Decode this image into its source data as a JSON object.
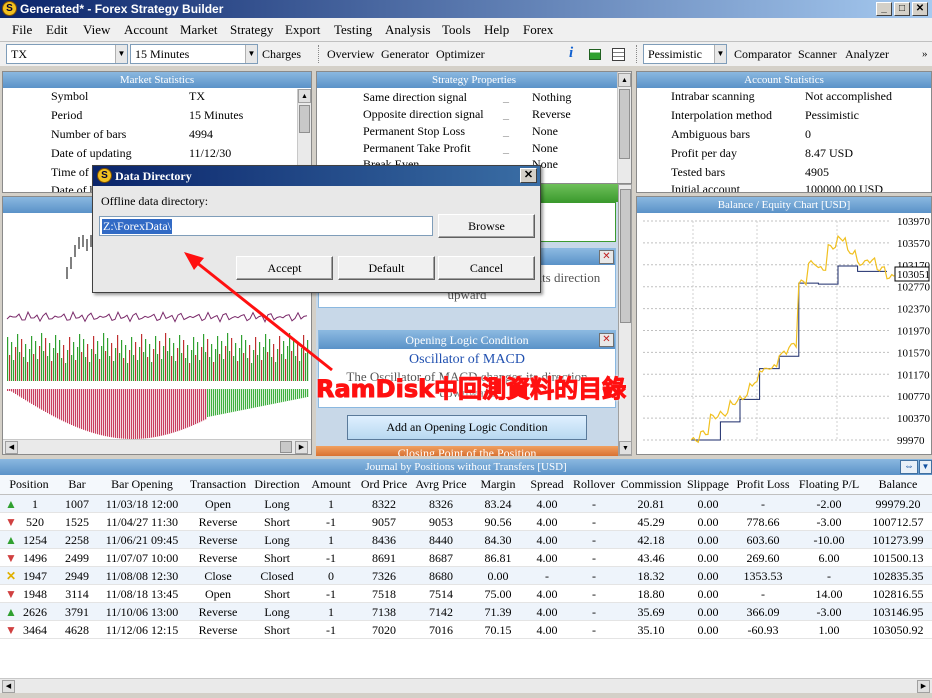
{
  "window": {
    "title": "Generated* - Forex Strategy Builder",
    "logo_letter": "S",
    "btn_min": "_",
    "btn_max": "□",
    "btn_close": "✕"
  },
  "menu": [
    "File",
    "Edit",
    "View",
    "Account",
    "Market",
    "Strategy",
    "Export",
    "Testing",
    "Analysis",
    "Tools",
    "Help",
    "Forex"
  ],
  "toolbar": {
    "symbol": "TX",
    "period": "15 Minutes",
    "charges": "Charges",
    "links": [
      "Overview",
      "Generator",
      "Optimizer"
    ],
    "info_glyph": "i",
    "mode": "Pessimistic",
    "links2": [
      "Comparator",
      "Scanner",
      "Analyzer"
    ]
  },
  "market_stats": {
    "title": "Market Statistics",
    "rows": [
      [
        "Symbol",
        "TX"
      ],
      [
        "Period",
        "15 Minutes"
      ],
      [
        "Number of bars",
        "4994"
      ],
      [
        "Date of updating",
        "11/12/30"
      ],
      [
        "Time of",
        ""
      ],
      [
        "Date of b",
        ""
      ]
    ]
  },
  "strategy_props": {
    "title": "Strategy Properties",
    "rows": [
      [
        "Same direction signal",
        "_",
        "Nothing"
      ],
      [
        "Opposite direction signal",
        "_",
        "Reverse"
      ],
      [
        "Permanent Stop Loss",
        "_",
        "None"
      ],
      [
        "Permanent Take Profit",
        "_",
        "None"
      ],
      [
        "Break Even",
        "",
        "None"
      ]
    ]
  },
  "account_stats": {
    "title": "Account Statistics",
    "rows": [
      [
        "Intrabar scanning",
        "Not accomplished"
      ],
      [
        "Interpolation method",
        "Pessimistic"
      ],
      [
        "Ambiguous bars",
        "0"
      ],
      [
        "Profit per day",
        "8.47 USD"
      ],
      [
        "Tested bars",
        "4905"
      ],
      [
        "Initial account",
        "100000.00 USD"
      ]
    ]
  },
  "logic": {
    "close_glyph": "✕",
    "filter_text": "The Market Facilitation Index changes its direction upward",
    "opening_title": "Opening Logic Condition",
    "opening_indicator": "Oscillator of MACD",
    "opening_text_a": "The Oscillator of MACD changes its direction",
    "opening_text_b": "downward",
    "add_button": "Add an Opening Logic Condition",
    "closing_title": "Closing Point of the Position"
  },
  "balance_chart": {
    "title": "Balance / Equity Chart [USD]",
    "current_value": "103051"
  },
  "chart_data": {
    "type": "line",
    "title": "Balance / Equity Chart [USD]",
    "y_ticks": [
      "103970",
      "103570",
      "103170",
      "102770",
      "102370",
      "101970",
      "101570",
      "101170",
      "100770",
      "100370",
      "99970"
    ],
    "ylim": [
      99970,
      103970
    ],
    "series": [
      {
        "name": "Balance",
        "color": "#1a2a6a",
        "values": [
          99970,
          99970,
          99970,
          100300,
          100300,
          100712,
          100712,
          101274,
          101274,
          101500,
          101500,
          102835,
          102835,
          102817,
          102817,
          103147,
          103147,
          103051,
          103051,
          103051,
          103051
        ]
      },
      {
        "name": "Equity",
        "color": "#f0c020",
        "values": [
          99970,
          100100,
          100400,
          100450,
          100650,
          100750,
          101000,
          101250,
          101300,
          101550,
          101700,
          102850,
          103200,
          103100,
          103500,
          103650,
          103400,
          103200,
          103250,
          103100,
          102950
        ]
      }
    ]
  },
  "dialog": {
    "title": "Data Directory",
    "label": "Offline data directory:",
    "path": "Z:\\ForexData\\",
    "browse": "Browse",
    "accept": "Accept",
    "default": "Default",
    "cancel": "Cancel"
  },
  "annotation": "RamDisk中回測資料的目錄",
  "journal": {
    "title": "Journal by Positions without Transfers [USD]",
    "headers": [
      "Position",
      "Bar",
      "Bar Opening Time",
      "Transaction",
      "Direction",
      "Amount",
      "Ord Price",
      "Avrg Price",
      "Margin",
      "Spread",
      "Rollover",
      "Commission",
      "Slippage",
      "Profit Loss",
      "Floating P/L",
      "Balance"
    ],
    "rows": [
      {
        "icon": "up",
        "cells": [
          "1",
          "1007",
          "11/03/18 12:00",
          "Open",
          "Long",
          "1",
          "8322",
          "8326",
          "83.24",
          "4.00",
          "-",
          "20.81",
          "0.00",
          "-",
          "-2.00",
          "99979.20"
        ]
      },
      {
        "icon": "revdown",
        "cells": [
          "520",
          "1525",
          "11/04/27 11:30",
          "Reverse",
          "Short",
          "-1",
          "9057",
          "9053",
          "90.56",
          "4.00",
          "-",
          "45.29",
          "0.00",
          "778.66",
          "-3.00",
          "100712.57"
        ]
      },
      {
        "icon": "revup",
        "cells": [
          "1254",
          "2258",
          "11/06/21 09:45",
          "Reverse",
          "Long",
          "1",
          "8436",
          "8440",
          "84.30",
          "4.00",
          "-",
          "42.18",
          "0.00",
          "603.60",
          "-10.00",
          "101273.99"
        ]
      },
      {
        "icon": "revdown",
        "cells": [
          "1496",
          "2499",
          "11/07/07 10:00",
          "Reverse",
          "Short",
          "-1",
          "8691",
          "8687",
          "86.81",
          "4.00",
          "-",
          "43.46",
          "0.00",
          "269.60",
          "6.00",
          "101500.13"
        ]
      },
      {
        "icon": "close",
        "cells": [
          "1947",
          "2949",
          "11/08/08 12:30",
          "Close",
          "Closed",
          "0",
          "7326",
          "8680",
          "0.00",
          "-",
          "-",
          "18.32",
          "0.00",
          "1353.53",
          "-",
          "102835.35"
        ]
      },
      {
        "icon": "down",
        "cells": [
          "1948",
          "3114",
          "11/08/18 13:45",
          "Open",
          "Short",
          "-1",
          "7518",
          "7514",
          "75.00",
          "4.00",
          "-",
          "18.80",
          "0.00",
          "-",
          "14.00",
          "102816.55"
        ]
      },
      {
        "icon": "revup",
        "cells": [
          "2626",
          "3791",
          "11/10/06 13:00",
          "Reverse",
          "Long",
          "1",
          "7138",
          "7142",
          "71.39",
          "4.00",
          "-",
          "35.69",
          "0.00",
          "366.09",
          "-3.00",
          "103146.95"
        ]
      },
      {
        "icon": "revdown",
        "cells": [
          "3464",
          "4628",
          "11/12/06 12:15",
          "Reverse",
          "Short",
          "-1",
          "7020",
          "7016",
          "70.15",
          "4.00",
          "-",
          "35.10",
          "0.00",
          "-60.93",
          "1.00",
          "103050.92"
        ]
      }
    ]
  }
}
